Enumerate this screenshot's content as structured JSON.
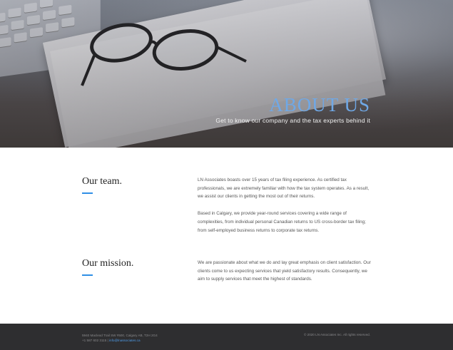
{
  "hero": {
    "title": "ABOUT US",
    "subtitle": "Get to know our company and the tax experts behind it"
  },
  "sections": [
    {
      "heading": "Our team.",
      "paragraphs": [
        "LN Associates boasts over 15 years of tax filing experience. As certified tax professionals, we are extremely familiar with how the tax system operates. As a result, we assist our clients in getting the most out of their returns.",
        "Based in Calgary, we provide year-round services covering a wide range of complexities, from individual personal Canadian returns to US cross-border tax filing; from self-employed business returns to corporate tax returns."
      ]
    },
    {
      "heading": "Our mission.",
      "paragraphs": [
        "We are passionate about what we do and lay great emphasis on client satisfaction. Our clients come to us expecting services that yield satisfactory results. Consequently, we aim to supply services that meet the highest of standards."
      ]
    }
  ],
  "footer": {
    "address": "5940 Macleod Trail SW #500, Calgary AB, T2H 2G4",
    "phone": "+1 587 602 3115",
    "separator": " | ",
    "email": "info@lnassociates.ca",
    "copyright": "© 2020 LN Associates Inc. All rights reserved."
  },
  "colors": {
    "accent": "#2f8fe6",
    "hero_title": "#6fa8e6",
    "footer_bg": "#2e2e30"
  }
}
